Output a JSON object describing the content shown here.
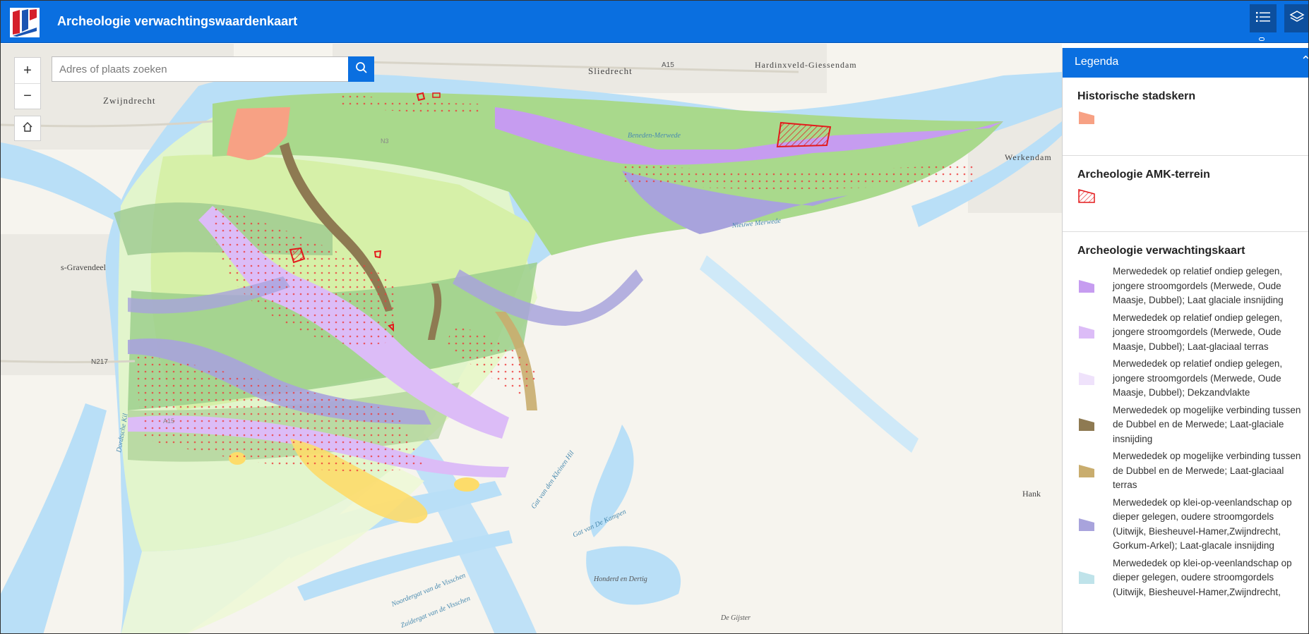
{
  "app": {
    "title": "Archeologie verwachtingswaardenkaart"
  },
  "header": {
    "list_icon": "list-icon",
    "layers_icon": "layers-icon"
  },
  "map_controls": {
    "zoom_in": "+",
    "zoom_out": "−",
    "home_icon": "home-icon",
    "search_placeholder": "Adres of plaats zoeken",
    "search_icon": "search-icon"
  },
  "map_labels": {
    "sliedrecht": "Sliedrecht",
    "hardinxveld": "Hardinxveld-Giessendam",
    "zwijndrecht": "Zwijndrecht",
    "werkendam": "Werkendam",
    "sgravendeel": "s-Gravendeel",
    "hank": "Hank",
    "a15_top": "A15",
    "a15_bottom": "A15",
    "n3": "N3",
    "n217": "N217",
    "beneden_merwede": "Beneden-Merwede",
    "nieuwe_merwede": "Nieuwe Merwede",
    "dordtsche_kil": "Dordtsche Kil",
    "gat_kleinen_hil": "Gat van den Kleinen Hil",
    "gat_kampen": "Gat van De Kampen",
    "honderd_dertig": "Honderd en Dertig",
    "noordergat": "Noordergat van de Visschen",
    "zuidergat": "Zuidergat van de Visschen",
    "de_gijster": "De Gijster"
  },
  "legend": {
    "title": "Legenda",
    "close_icon": "collapse-icon",
    "sections": [
      {
        "title": "Historische stadskern",
        "items": [
          {
            "label": "",
            "color": "#f7a184",
            "style": "solid"
          }
        ]
      },
      {
        "title": "Archeologie AMK-terrein",
        "items": [
          {
            "label": "",
            "color": "#e31a1c",
            "style": "hatch"
          }
        ]
      },
      {
        "title": "Archeologie verwachtingskaart",
        "items": [
          {
            "label": "Merwededek op relatief ondiep gelegen, jongere stroomgordels (Merwede, Oude Maasje, Dubbel); Laat glaciale insnijding",
            "color": "#c69cf0",
            "style": "solid"
          },
          {
            "label": "Merwededek op relatief ondiep gelegen, jongere stroomgordels (Merwede, Oude Maasje, Dubbel); Laat-glaciaal terras",
            "color": "#dcbcf7",
            "style": "solid"
          },
          {
            "label": "Merwededek op relatief ondiep gelegen, jongere stroomgordels (Merwede, Oude Maasje, Dubbel); Dekzandvlakte",
            "color": "#efe2fb",
            "style": "solid"
          },
          {
            "label": "Merwededek op mogelijke verbinding tussen de Dubbel en de Merwede; Laat-glaciale insnijding",
            "color": "#8e7a52",
            "style": "solid"
          },
          {
            "label": "Merwededek op mogelijke verbinding tussen de Dubbel en de Merwede; Laat-glaciaal terras",
            "color": "#c9ad6e",
            "style": "solid"
          },
          {
            "label": "Merwededek op klei-op-veenlandschap op dieper gelegen, oudere stroomgordels (Uitwijk, Biesheuvel-Hamer,Zwijndrecht, Gorkum-Arkel); Laat-glacale insnijding",
            "color": "#a8a3dc",
            "style": "solid"
          },
          {
            "label": "Merwededek op klei-op-veenlandschap op dieper gelegen, oudere stroomgordels (Uitwijk, Biesheuvel-Hamer,Zwijndrecht,",
            "color": "#bfe3ea",
            "style": "solid"
          }
        ]
      }
    ]
  }
}
